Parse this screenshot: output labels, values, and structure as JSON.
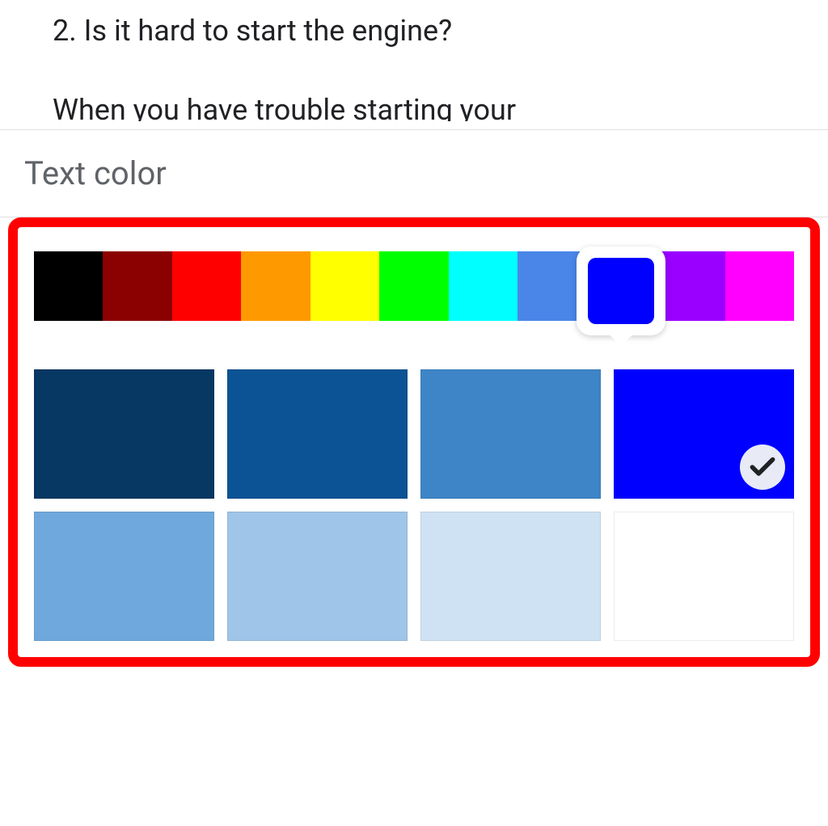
{
  "document": {
    "line1": "2. Is it hard to start the engine?",
    "line2": "When you have trouble starting your"
  },
  "panel": {
    "title": "Text color"
  },
  "hue_row": {
    "colors": [
      "#000000",
      "#8b0000",
      "#ff0000",
      "#ff9900",
      "#ffff00",
      "#00ff00",
      "#00ffff",
      "#4a86e8",
      "#0000ff",
      "#9900ff",
      "#ff00ff"
    ],
    "selected_index": 8,
    "selected_color": "#0000ff"
  },
  "shades": {
    "items": [
      {
        "color": "#073763",
        "selected": false
      },
      {
        "color": "#0b5394",
        "selected": false
      },
      {
        "color": "#3d85c6",
        "selected": false
      },
      {
        "color": "#0000ff",
        "selected": true
      },
      {
        "color": "#6fa8dc",
        "selected": false
      },
      {
        "color": "#9fc5e8",
        "selected": false
      },
      {
        "color": "#cfe2f3",
        "selected": false
      },
      {
        "color": "#ffffff",
        "selected": false
      }
    ]
  }
}
